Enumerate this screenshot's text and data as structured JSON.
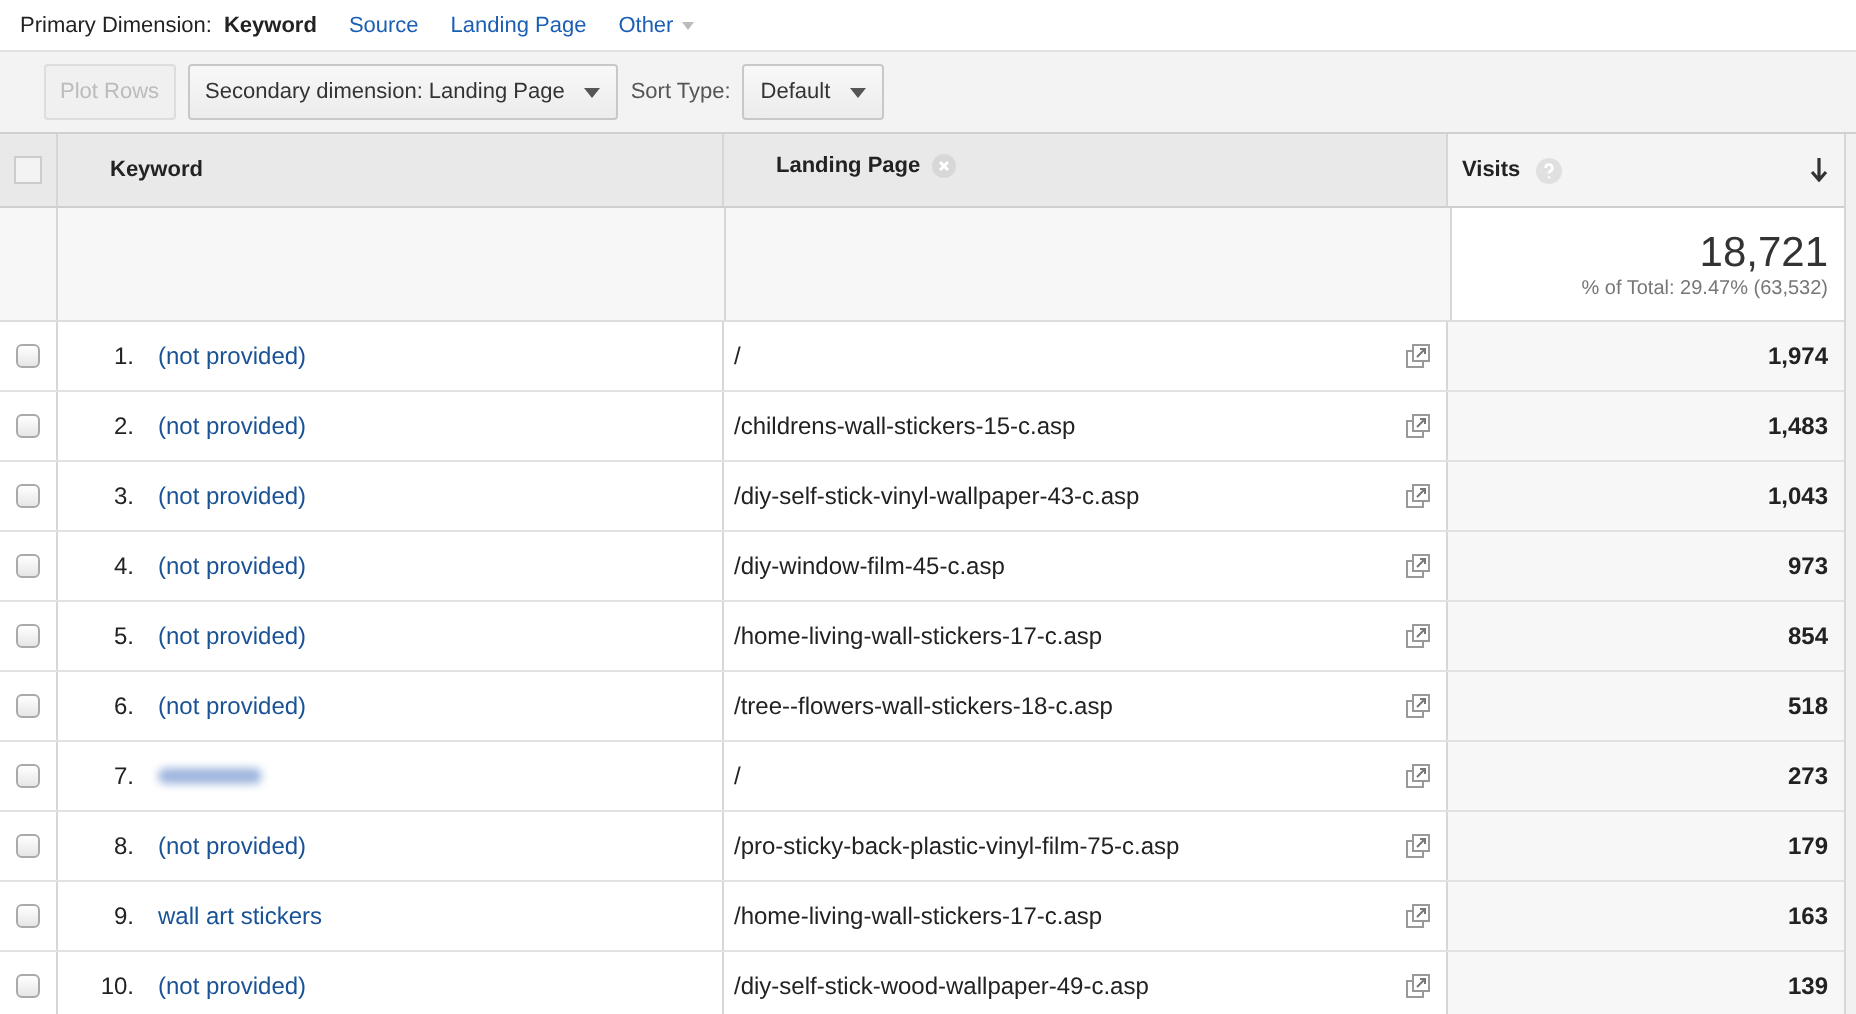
{
  "primary_dimension": {
    "label": "Primary Dimension:",
    "options": [
      {
        "label": "Keyword",
        "selected": true,
        "dropdown": false
      },
      {
        "label": "Source",
        "selected": false,
        "dropdown": false
      },
      {
        "label": "Landing Page",
        "selected": false,
        "dropdown": false
      },
      {
        "label": "Other",
        "selected": false,
        "dropdown": true
      }
    ]
  },
  "toolbar": {
    "plot_rows": {
      "label": "Plot Rows",
      "disabled": true
    },
    "secondary_dimension": "Secondary dimension: Landing Page",
    "sort_label": "Sort Type:",
    "sort_value": "Default"
  },
  "table": {
    "select_all_checked": false,
    "columns": {
      "keyword": "Keyword",
      "landing_page": "Landing Page",
      "visits": "Visits"
    },
    "total": {
      "value": "18,721",
      "share": "% of Total: 29.47% (63,532)"
    },
    "rows": [
      {
        "index": "1.",
        "kind": "link",
        "keyword": "(not provided)",
        "landing_page": "/",
        "visits": "1,974",
        "checked": false
      },
      {
        "index": "2.",
        "kind": "link",
        "keyword": "(not provided)",
        "landing_page": "/childrens-wall-stickers-15-c.asp",
        "visits": "1,483",
        "checked": false
      },
      {
        "index": "3.",
        "kind": "link",
        "keyword": "(not provided)",
        "landing_page": "/diy-self-stick-vinyl-wallpaper-43-c.asp",
        "visits": "1,043",
        "checked": false
      },
      {
        "index": "4.",
        "kind": "link",
        "keyword": "(not provided)",
        "landing_page": "/diy-window-film-45-c.asp",
        "visits": "973",
        "checked": false
      },
      {
        "index": "5.",
        "kind": "link",
        "keyword": "(not provided)",
        "landing_page": "/home-living-wall-stickers-17-c.asp",
        "visits": "854",
        "checked": false
      },
      {
        "index": "6.",
        "kind": "link",
        "keyword": "(not provided)",
        "landing_page": "/tree--flowers-wall-stickers-18-c.asp",
        "visits": "518",
        "checked": false
      },
      {
        "index": "7.",
        "kind": "blurred",
        "landing_page": "/",
        "visits": "273",
        "checked": false
      },
      {
        "index": "8.",
        "kind": "link",
        "keyword": "(not provided)",
        "landing_page": "/pro-sticky-back-plastic-vinyl-film-75-c.asp",
        "visits": "179",
        "checked": false
      },
      {
        "index": "9.",
        "kind": "link",
        "keyword": "wall art stickers",
        "landing_page": "/home-living-wall-stickers-17-c.asp",
        "visits": "163",
        "checked": false
      },
      {
        "index": "10.",
        "kind": "link",
        "keyword": "(not provided)",
        "landing_page": "/diy-self-stick-wood-wallpaper-49-c.asp",
        "visits": "139",
        "checked": false
      }
    ]
  }
}
